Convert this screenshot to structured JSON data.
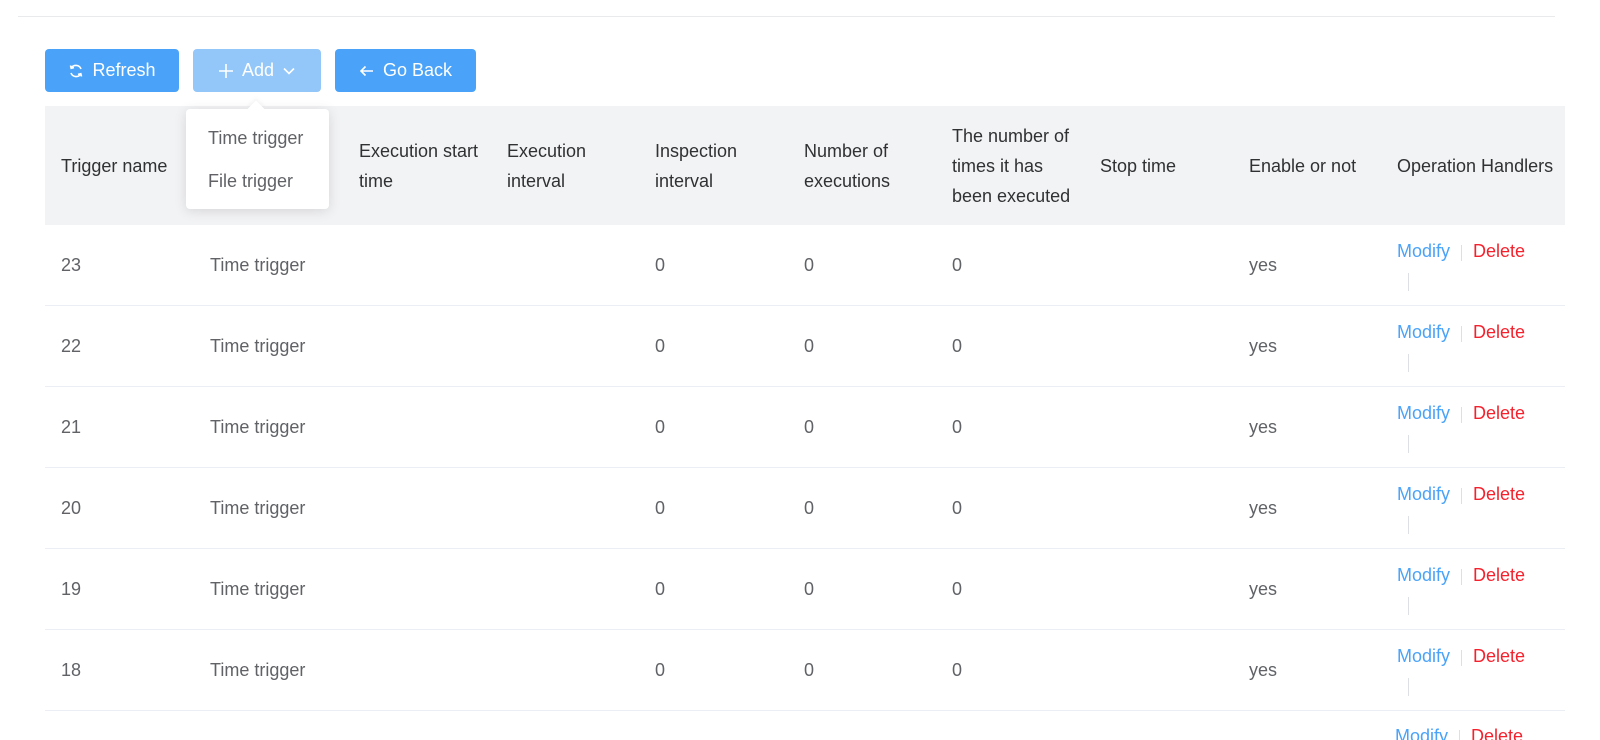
{
  "toolbar": {
    "refresh_label": "Refresh",
    "add_label": "Add",
    "back_label": "Go Back"
  },
  "add_menu": {
    "items": [
      "Time trigger",
      "File trigger"
    ]
  },
  "table": {
    "headers": [
      "Trigger name",
      "",
      "Execution start time",
      "Execution interval",
      "Inspection interval",
      "Number of executions",
      "The number of times it has been executed",
      "Stop time",
      "Enable or not",
      "Operation Handlers"
    ],
    "rows": [
      {
        "name": "23",
        "type": "Time trigger",
        "start": "",
        "exec_interval": "",
        "inspection": "0",
        "num_exec": "0",
        "times_executed": "0",
        "stop": "",
        "enabled": "yes"
      },
      {
        "name": "22",
        "type": "Time trigger",
        "start": "",
        "exec_interval": "",
        "inspection": "0",
        "num_exec": "0",
        "times_executed": "0",
        "stop": "",
        "enabled": "yes"
      },
      {
        "name": "21",
        "type": "Time trigger",
        "start": "",
        "exec_interval": "",
        "inspection": "0",
        "num_exec": "0",
        "times_executed": "0",
        "stop": "",
        "enabled": "yes"
      },
      {
        "name": "20",
        "type": "Time trigger",
        "start": "",
        "exec_interval": "",
        "inspection": "0",
        "num_exec": "0",
        "times_executed": "0",
        "stop": "",
        "enabled": "yes"
      },
      {
        "name": "19",
        "type": "Time trigger",
        "start": "",
        "exec_interval": "",
        "inspection": "0",
        "num_exec": "0",
        "times_executed": "0",
        "stop": "",
        "enabled": "yes"
      },
      {
        "name": "18",
        "type": "Time trigger",
        "start": "",
        "exec_interval": "",
        "inspection": "0",
        "num_exec": "0",
        "times_executed": "0",
        "stop": "",
        "enabled": "yes"
      }
    ],
    "actions": {
      "modify": "Modify",
      "delete": "Delete"
    }
  },
  "icons": {
    "refresh": "refresh-icon",
    "add": "plus-icon",
    "add_caret": "chevron-down-icon",
    "back": "arrow-left-icon"
  },
  "colors": {
    "primary": "#4aa3f8",
    "primary_disabled": "#93c6f9",
    "danger": "#f5222d",
    "header_bg": "#f2f3f5",
    "text": "#606266"
  }
}
